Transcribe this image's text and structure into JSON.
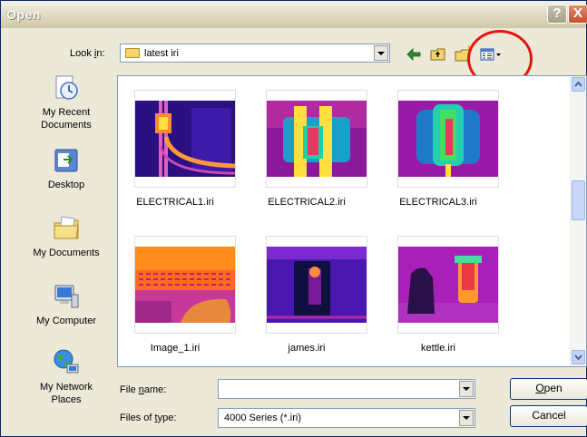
{
  "window": {
    "title": "Open",
    "help_label": "?",
    "close_label": "X"
  },
  "look_in": {
    "label": "Look in:",
    "value": "latest iri"
  },
  "places": [
    {
      "label_1": "My Recent",
      "label_2": "Documents",
      "icon": "recent-documents-icon"
    },
    {
      "label_1": "Desktop",
      "label_2": "",
      "icon": "desktop-icon"
    },
    {
      "label_1": "My Documents",
      "label_2": "",
      "icon": "my-documents-icon"
    },
    {
      "label_1": "My Computer",
      "label_2": "",
      "icon": "my-computer-icon"
    },
    {
      "label_1": "My Network",
      "label_2": "Places",
      "icon": "network-places-icon"
    }
  ],
  "files": [
    {
      "name": "ELECTRICAL1.iri"
    },
    {
      "name": "ELECTRICAL2.iri"
    },
    {
      "name": "ELECTRICAL3.iri"
    },
    {
      "name": "Image_1.iri"
    },
    {
      "name": "james.iri"
    },
    {
      "name": "kettle.iri"
    }
  ],
  "file_name": {
    "label": "File name:",
    "value": ""
  },
  "file_type": {
    "label": "Files of type:",
    "value": "4000 Series (*.iri)"
  },
  "buttons": {
    "open": "Open",
    "cancel": "Cancel"
  },
  "colors": {
    "annotation": "#e31414",
    "accent": "#0a246a"
  }
}
